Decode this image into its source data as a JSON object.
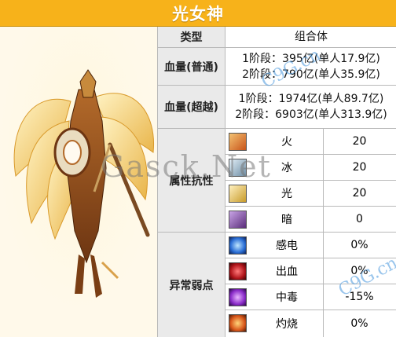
{
  "title": "光女神",
  "type_label": "类型",
  "type_value": "组合体",
  "hp_normal": {
    "label": "血量(普通)",
    "stage1": "1阶段：395亿(单人17.9亿)",
    "stage2": "2阶段：790亿(单人35.9亿)"
  },
  "hp_super": {
    "label": "血量(超越)",
    "stage1": "1阶段：1974亿(单人89.7亿)",
    "stage2": "2阶段：6903亿(单人313.9亿)"
  },
  "attr_resist": {
    "label": "属性抗性",
    "items": [
      {
        "name": "火",
        "value": "20",
        "icon": "fire-element-icon",
        "color": "#c8541a"
      },
      {
        "name": "冰",
        "value": "20",
        "icon": "ice-element-icon",
        "color": "#6f8fa6"
      },
      {
        "name": "光",
        "value": "20",
        "icon": "light-element-icon",
        "color": "#c89b2a"
      },
      {
        "name": "暗",
        "value": "0",
        "icon": "dark-element-icon",
        "color": "#5a2d7a"
      }
    ]
  },
  "status_weak": {
    "label": "异常弱点",
    "items": [
      {
        "name": "感电",
        "value": "0%",
        "icon": "shock-status-icon",
        "color": "#2b6fd6"
      },
      {
        "name": "出血",
        "value": "0%",
        "icon": "bleed-status-icon",
        "color": "#b0151b"
      },
      {
        "name": "中毒",
        "value": "-15%",
        "icon": "poison-status-icon",
        "color": "#8a2bc9"
      },
      {
        "name": "灼烧",
        "value": "0%",
        "icon": "burn-status-icon",
        "color": "#d9571b"
      }
    ]
  },
  "watermarks": {
    "site1": "Gasck.Net",
    "site2": "C9G.cn"
  }
}
